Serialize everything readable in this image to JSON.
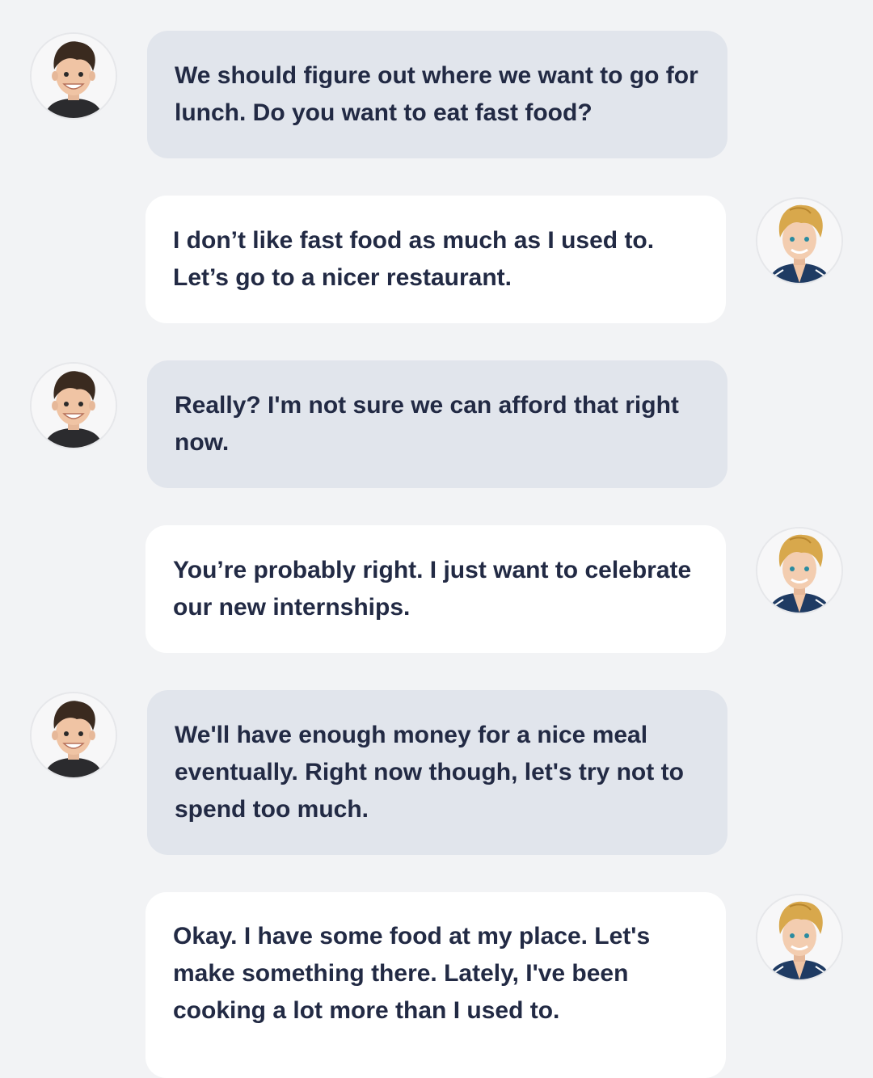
{
  "conversation": {
    "messages": [
      {
        "speaker": "dark-haired-boy",
        "side": "left",
        "text": "We should figure out where we want to go for lunch. Do you want to eat fast food?"
      },
      {
        "speaker": "blond-boy",
        "side": "right",
        "text": "I don’t like fast food as much as I used to. Let’s go to a nicer restaurant."
      },
      {
        "speaker": "dark-haired-boy",
        "side": "left",
        "text": "Really? I'm not sure we can afford that right now."
      },
      {
        "speaker": "blond-boy",
        "side": "right",
        "text": "You’re probably right. I just want to celebrate our new internships."
      },
      {
        "speaker": "dark-haired-boy",
        "side": "left",
        "text": "We'll have enough money for a nice meal eventually. Right now though, let's try not to spend too much."
      },
      {
        "speaker": "blond-boy",
        "side": "right",
        "text": "Okay. I have some food at my place. Let's make something there. Lately, I've been cooking a lot more than I used to."
      }
    ]
  },
  "colors": {
    "background": "#f2f3f5",
    "left_bubble": "#e1e5ec",
    "right_bubble": "#ffffff",
    "text": "#222a44",
    "dark_hair": "#3a2a1f",
    "blond_hair": "#d8a84c",
    "jacket_blue": "#1f3b63"
  },
  "icons": {
    "left_avatar": "dark-haired-boy-avatar-icon",
    "right_avatar": "blond-boy-avatar-icon"
  }
}
